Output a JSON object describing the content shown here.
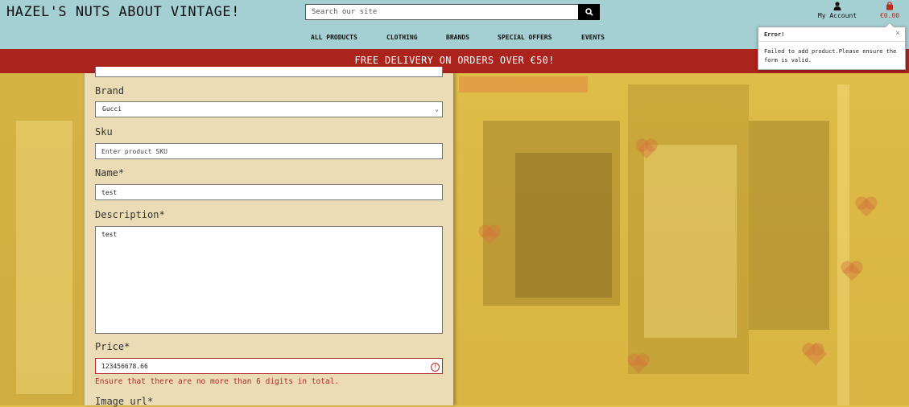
{
  "header": {
    "logo": "HAZEL'S NUTS ABOUT VINTAGE!",
    "search_placeholder": "Search our site",
    "account_label": "My Account",
    "bag_total": "€0.00",
    "nav": [
      "ALL PRODUCTS",
      "CLOTHING",
      "BRANDS",
      "SPECIAL OFFERS",
      "EVENTS"
    ]
  },
  "banner": {
    "text": "FREE DELIVERY ON ORDERS OVER €50!"
  },
  "toast": {
    "title": "Error!",
    "close": "×",
    "message": "Failed to add product.Please ensure the form is valid."
  },
  "form": {
    "brand_label": "Brand",
    "brand_value": "Gucci",
    "sku_label": "Sku",
    "sku_placeholder": "Enter product SKU",
    "name_label": "Name*",
    "name_value": "test",
    "description_label": "Description*",
    "description_value": "test",
    "price_label": "Price*",
    "price_value": "123456678.66",
    "price_error": "Ensure that there are no more than 6 digits in total.",
    "image_url_label": "Image url*"
  },
  "colors": {
    "header_bg": "#a4cfd3",
    "banner_bg": "#ab231d",
    "panel_bg": "#ecdcb6",
    "error": "#b02a2a",
    "bag": "#c0281d"
  },
  "icons": {
    "search": "search-icon",
    "account": "user-icon",
    "bag": "shopping-bag-icon",
    "error": "error-circle-icon",
    "close": "close-icon"
  }
}
